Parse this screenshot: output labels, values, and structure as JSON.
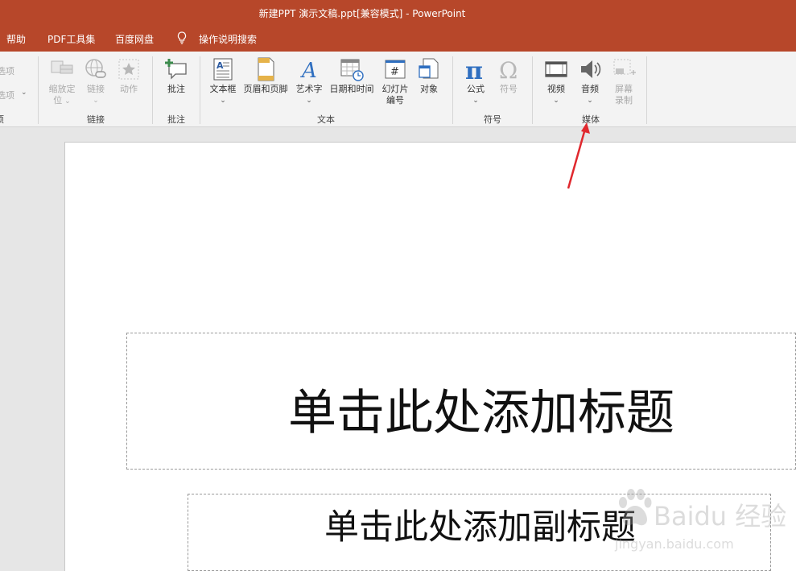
{
  "window": {
    "title": "新建PPT 演示文稿.ppt[兼容模式]  -  PowerPoint"
  },
  "tabs": [
    {
      "label": "帮助"
    },
    {
      "label": "PDF工具集"
    },
    {
      "label": "百度网盘"
    }
  ],
  "tell_me": {
    "label": "操作说明搜索",
    "icon": "lightbulb-icon"
  },
  "ribbon": {
    "cut_left": {
      "item1": "选项",
      "item2": "选项",
      "group": "项"
    },
    "links": {
      "group": "链接",
      "zoom": {
        "line1": "缩放定",
        "line2": "位"
      },
      "link": "链接",
      "action": "动作"
    },
    "comments": {
      "group": "批注",
      "comment": "批注"
    },
    "text": {
      "group": "文本",
      "textbox": "文本框",
      "header_footer": "页眉和页脚",
      "wordart": "艺术字",
      "datetime": "日期和时间",
      "slide_number": {
        "line1": "幻灯片",
        "line2": "编号"
      },
      "object": "对象"
    },
    "symbols": {
      "group": "符号",
      "equation": "公式",
      "symbol": "符号"
    },
    "media": {
      "group": "媒体",
      "video": "视频",
      "audio": "音频",
      "screen_recording": {
        "line1": "屏幕",
        "line2": "录制"
      }
    }
  },
  "slide": {
    "title_placeholder": "单击此处添加标题",
    "subtitle_placeholder": "单击此处添加副标题"
  },
  "watermark": {
    "line1": "Baidu 经验",
    "line2": "jingyan.baidu.com"
  },
  "colors": {
    "accent": "#b7472a",
    "ribbon_bg": "#f3f3f3",
    "arrow": "#e0282e"
  }
}
